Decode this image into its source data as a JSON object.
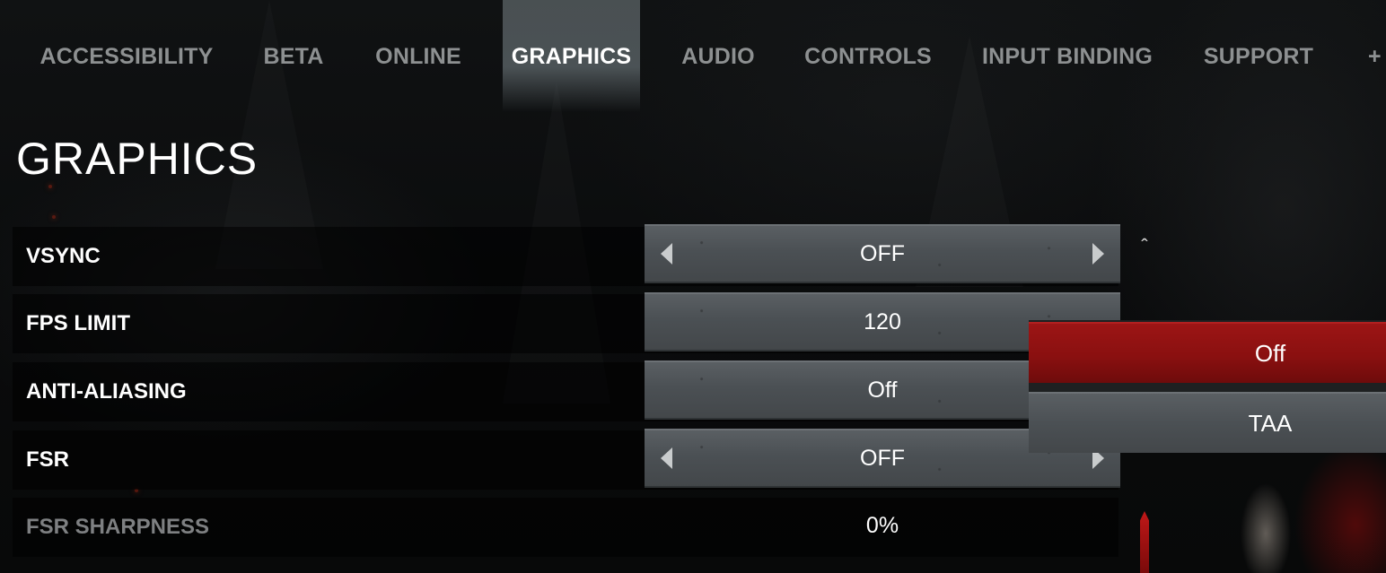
{
  "tabs": [
    {
      "label": "ACCESSIBILITY"
    },
    {
      "label": "BETA"
    },
    {
      "label": "ONLINE"
    },
    {
      "label": "GRAPHICS"
    },
    {
      "label": "AUDIO"
    },
    {
      "label": "CONTROLS"
    },
    {
      "label": "INPUT BINDING"
    },
    {
      "label": "SUPPORT"
    }
  ],
  "page_title": "GRAPHICS",
  "settings": {
    "vsync": {
      "label": "VSYNC",
      "value": "OFF"
    },
    "fps_limit": {
      "label": "FPS LIMIT",
      "value": "120"
    },
    "anti_aliasing": {
      "label": "ANTI-ALIASING",
      "value": "Off"
    },
    "fsr": {
      "label": "FSR",
      "value": "OFF"
    },
    "fsr_sharpness": {
      "label": "FSR SHARPNESS",
      "value": "0%"
    }
  },
  "dropdown": {
    "options": [
      "Off",
      "TAA"
    ],
    "selected": "Off"
  },
  "icons": {
    "left_arrow": "chevron-left-icon",
    "right_arrow": "chevron-right-icon",
    "scroll_up": "caret-up-icon"
  },
  "colors": {
    "selected_option": "#9c1515",
    "active_tab_text": "#ffffff",
    "inactive_tab_text": "#8d9091"
  }
}
